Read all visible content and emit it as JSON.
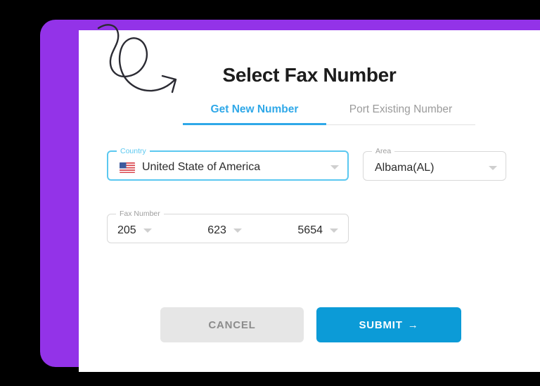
{
  "theme": {
    "backdrop_color": "#9333e8",
    "accent_blue": "#2fa8e8",
    "submit_blue": "#0c9bd7",
    "focus_border": "#5bc8f0",
    "cancel_gray": "#e6e6e6"
  },
  "dialog": {
    "title": "Select Fax Number"
  },
  "tabs": [
    {
      "label": "Get New Number",
      "active": true
    },
    {
      "label": "Port Existing Number",
      "active": false
    }
  ],
  "form": {
    "country": {
      "legend": "Country",
      "value": "United State of America",
      "flag": "us-flag-icon",
      "focused": true
    },
    "area": {
      "legend": "Area",
      "value": "Albama(AL)",
      "focused": false
    },
    "fax_number": {
      "legend": "Fax Number",
      "segments": [
        {
          "value": "205"
        },
        {
          "value": "623"
        },
        {
          "value": "5654"
        }
      ]
    }
  },
  "actions": {
    "cancel_label": "CANCEL",
    "submit_label": "SUBMIT",
    "submit_arrow": "→"
  }
}
